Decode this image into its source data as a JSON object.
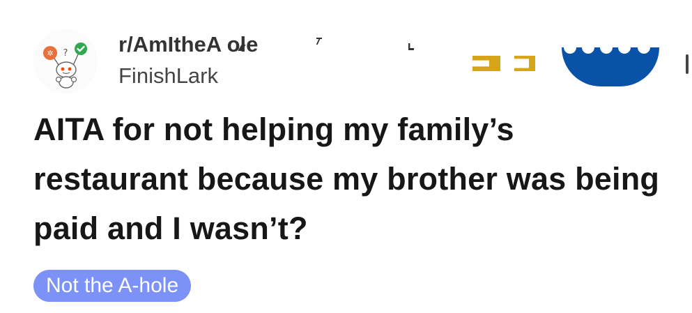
{
  "post": {
    "subreddit": "r/AmItheA  ole",
    "username": "FinishLark",
    "title": "AITA for not helping my family’s restaurant because my brother was being paid and I wasn’t?",
    "flair": "Not the A-hole"
  },
  "icons": {
    "avatar": "reddit-snoo-avatar-icon"
  },
  "colors": {
    "flair_background": "#7d92f6",
    "flair_text": "#ffffff",
    "title_text": "#161718",
    "subreddit_text": "#333333",
    "username_text": "#444444",
    "artifact_blue": "#0a51a8",
    "artifact_gold": "#d6a419"
  }
}
